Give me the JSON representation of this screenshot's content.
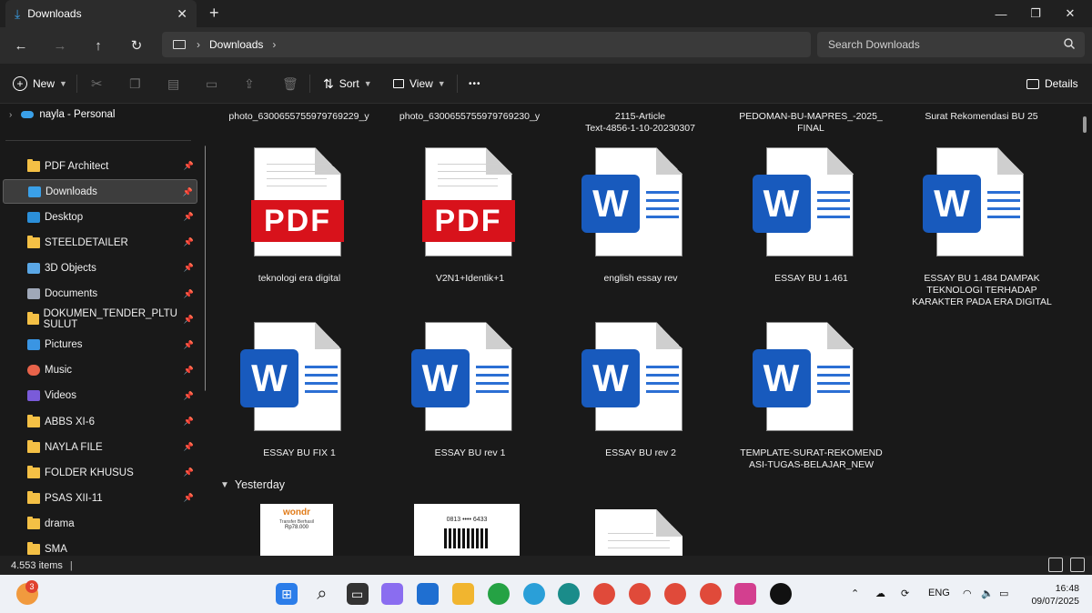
{
  "window": {
    "tab_title": "Downloads",
    "close_tab_glyph": "✕",
    "new_tab_glyph": "+",
    "minimize_glyph": "—",
    "maximize_glyph": "❐",
    "close_glyph": "✕"
  },
  "nav": {
    "breadcrumb": "Downloads",
    "search_placeholder": "Search Downloads"
  },
  "commands": {
    "new_label": "New",
    "sort_label": "Sort",
    "view_label": "View",
    "more_label": "•••",
    "details_label": "Details"
  },
  "sidebar": {
    "cloud_item": "nayla - Personal",
    "items": [
      {
        "label": "PDF Architect",
        "icon": "folder-icon",
        "pinned": true
      },
      {
        "label": "Downloads",
        "icon": "download-icon",
        "pinned": true,
        "selected": true
      },
      {
        "label": "Desktop",
        "icon": "desktop-icon",
        "pinned": true
      },
      {
        "label": "STEELDETAILER",
        "icon": "folder-icon",
        "pinned": true
      },
      {
        "label": "3D Objects",
        "icon": "cube-icon",
        "pinned": true
      },
      {
        "label": "Documents",
        "icon": "document-icon",
        "pinned": true
      },
      {
        "label": "DOKUMEN_TENDER_PLTU SULUT",
        "icon": "folder-icon",
        "pinned": true
      },
      {
        "label": "Pictures",
        "icon": "pictures-icon",
        "pinned": true
      },
      {
        "label": "Music",
        "icon": "music-icon",
        "pinned": true
      },
      {
        "label": "Videos",
        "icon": "videos-icon",
        "pinned": true
      },
      {
        "label": "ABBS XI-6",
        "icon": "folder-icon",
        "pinned": true
      },
      {
        "label": "NAYLA FILE",
        "icon": "folder-icon",
        "pinned": true
      },
      {
        "label": "FOLDER KHUSUS",
        "icon": "folder-icon",
        "pinned": true
      },
      {
        "label": "PSAS XII-11",
        "icon": "folder-icon",
        "pinned": true
      },
      {
        "label": "drama",
        "icon": "folder-icon",
        "pinned": false
      },
      {
        "label": "SMA",
        "icon": "folder-icon",
        "pinned": false
      }
    ]
  },
  "content": {
    "top_row_names": [
      "photo_6300655755979769229_y",
      "photo_6300655755979769230_y",
      "2115-Article\nText-4856-1-10-20230307",
      "PEDOMAN-BU-MAPRES_-2025_\nFINAL",
      "Surat Rekomendasi BU 25"
    ],
    "files": [
      {
        "name": "teknologi era digital",
        "type": "pdf",
        "badge": "PDF"
      },
      {
        "name": "V2N1+Identik+1",
        "type": "pdf",
        "badge": "PDF"
      },
      {
        "name": "english essay rev",
        "type": "word",
        "badge": "W"
      },
      {
        "name": "ESSAY BU 1.461",
        "type": "word",
        "badge": "W"
      },
      {
        "name": "ESSAY BU 1.484 DAMPAK TEKNOLOGI TERHADAP KARAKTER PADA ERA DIGITAL",
        "type": "word",
        "badge": "W"
      },
      {
        "name": "ESSAY BU FIX 1",
        "type": "word",
        "badge": "W"
      },
      {
        "name": "ESSAY BU rev 1",
        "type": "word",
        "badge": "W"
      },
      {
        "name": "ESSAY BU rev 2",
        "type": "word",
        "badge": "W"
      },
      {
        "name": "TEMPLATE-SURAT-REKOMEND ASI-TUGAS-BELAJAR_NEW",
        "type": "word",
        "badge": "W"
      }
    ],
    "group_label": "Yesterday",
    "thumb1_brand": "wondr",
    "thumb1_lines": [
      "Transfer Berhasil",
      "Rp78.000"
    ],
    "thumb2_lines": [
      "0813 •••• 6433"
    ]
  },
  "status": {
    "item_count": "4.553 items",
    "cursor": "|"
  },
  "taskbar": {
    "notif_badge": "3",
    "tray_lang": "ENG",
    "time": "16:48",
    "date": "09/07/2025",
    "icons": [
      "start-icon",
      "search-icon",
      "task-view-icon",
      "copilot-icon",
      "store-icon",
      "file-explorer-icon",
      "whatsapp-icon",
      "telegram-icon",
      "edge-icon",
      "chrome-icon",
      "chrome-icon",
      "chrome-icon",
      "chrome-icon",
      "instagram-icon",
      "tiktok-icon"
    ]
  }
}
